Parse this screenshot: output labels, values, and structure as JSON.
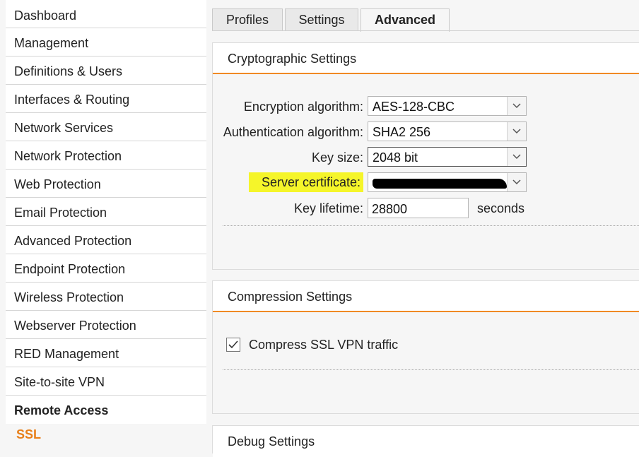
{
  "sidebar": {
    "items": [
      {
        "label": "Dashboard"
      },
      {
        "label": "Management"
      },
      {
        "label": "Definitions & Users"
      },
      {
        "label": "Interfaces & Routing"
      },
      {
        "label": "Network Services"
      },
      {
        "label": "Network Protection"
      },
      {
        "label": "Web Protection"
      },
      {
        "label": "Email Protection"
      },
      {
        "label": "Advanced Protection"
      },
      {
        "label": "Endpoint Protection"
      },
      {
        "label": "Wireless Protection"
      },
      {
        "label": "Webserver Protection"
      },
      {
        "label": "RED Management"
      },
      {
        "label": "Site-to-site VPN"
      }
    ],
    "section": "Remote Access",
    "sub_item": "SSL"
  },
  "tabs": [
    {
      "label": "Profiles"
    },
    {
      "label": "Settings"
    },
    {
      "label": "Advanced",
      "active": true
    }
  ],
  "crypto": {
    "title": "Cryptographic Settings",
    "encryption_label": "Encryption algorithm:",
    "encryption_value": "AES-128-CBC",
    "auth_label": "Authentication algorithm:",
    "auth_value": "SHA2 256",
    "keysize_label": "Key size:",
    "keysize_value": "2048 bit",
    "cert_label": "Server certificate:",
    "lifetime_label": "Key lifetime:",
    "lifetime_value": "28800",
    "lifetime_unit": "seconds"
  },
  "compression": {
    "title": "Compression Settings",
    "checkbox_label": "Compress SSL VPN traffic",
    "checked": true
  },
  "debug": {
    "title": "Debug Settings"
  },
  "colors": {
    "accent": "#f08a24",
    "highlight": "#f5f52a",
    "sub_item": "#e8801a"
  },
  "icons": {
    "dropdown": "chevron-down-icon",
    "check": "check-icon"
  }
}
